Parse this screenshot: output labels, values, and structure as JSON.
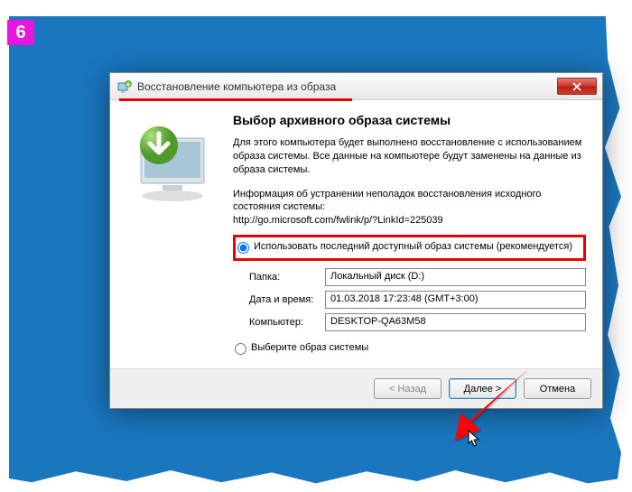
{
  "step_badge": "6",
  "dialog": {
    "title": "Восстановление компьютера из образа",
    "heading": "Выбор архивного образа системы",
    "description": "Для этого компьютера будет выполнено восстановление с использованием образа системы. Все данные на компьютере будут заменены на данные из образа системы.",
    "troubleshoot_text": "Информация об устранении неполадок восстановления исходного состояния системы:",
    "troubleshoot_link": "http://go.microsoft.com/fwlink/p/?LinkId=225039",
    "radio_recommended": "Использовать последний доступный образ системы (рекомендуется)",
    "radio_select": "Выберите образ системы",
    "fields": {
      "folder_label": "Папка:",
      "folder_value": "Локальный диск (D:)",
      "datetime_label": "Дата и время:",
      "datetime_value": "01.03.2018 17:23:48 (GMT+3:00)",
      "computer_label": "Компьютер:",
      "computer_value": "DESKTOP-QA63M58"
    },
    "back": "< Назад",
    "next": "Далее >",
    "cancel": "Отмена"
  }
}
